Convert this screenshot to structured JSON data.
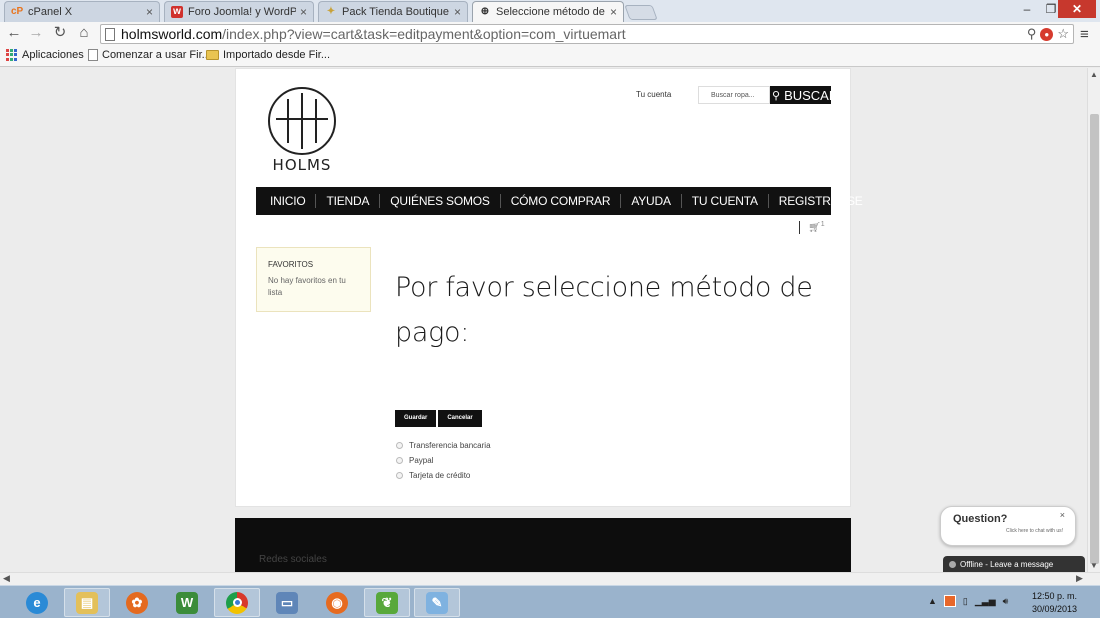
{
  "browser": {
    "tabs": [
      {
        "label": "cPanel X",
        "favicon": "cP",
        "color": "#e8741e"
      },
      {
        "label": "Foro Joomla! y WordPress",
        "favicon": "w",
        "color": "#d0312d"
      },
      {
        "label": "Pack Tienda Boutique - A",
        "favicon": "✦",
        "color": "#c8a23a"
      },
      {
        "label": "Seleccione método de pag",
        "favicon": "⊕",
        "color": "#333333"
      }
    ],
    "url_host": "holmsworld.com",
    "url_path": "/index.php?view=cart&task=editpayment&option=com_virtuemart",
    "bookmarks": [
      "Aplicaciones",
      "Comenzar a usar Fir...",
      "Importado desde Fir..."
    ]
  },
  "site": {
    "logo_text": "HOLMS",
    "account_link": "Tu cuenta",
    "search_placeholder": "Buscar ropa...",
    "search_button": "BUSCAR",
    "nav": [
      "INICIO",
      "TIENDA",
      "QUIÉNES SOMOS",
      "CÓMO COMPRAR",
      "AYUDA",
      "TU CUENTA",
      "REGISTRARSE"
    ],
    "cart_count": "1",
    "favorites": {
      "title": "FAVORITOS",
      "empty_text": "No hay favoritos en tu lista"
    },
    "page_title": "Por favor seleccione método de pago:",
    "buttons": {
      "save": "Guardar",
      "cancel": "Cancelar"
    },
    "payment_options": [
      "Transferencia bancaria",
      "Paypal",
      "Tarjeta de crédito"
    ],
    "footer_title": "Redes sociales"
  },
  "chat": {
    "question": "Question?",
    "sub": "Click here to chat with us!",
    "status": "Offline - Leave a message"
  },
  "taskbar": {
    "clock_time": "12:50 p. m.",
    "clock_date": "30/09/2013"
  },
  "colors": {
    "nav_bg": "#111111",
    "fav_box_bg": "#fdfcee",
    "taskbar": "#9ab3cc"
  }
}
